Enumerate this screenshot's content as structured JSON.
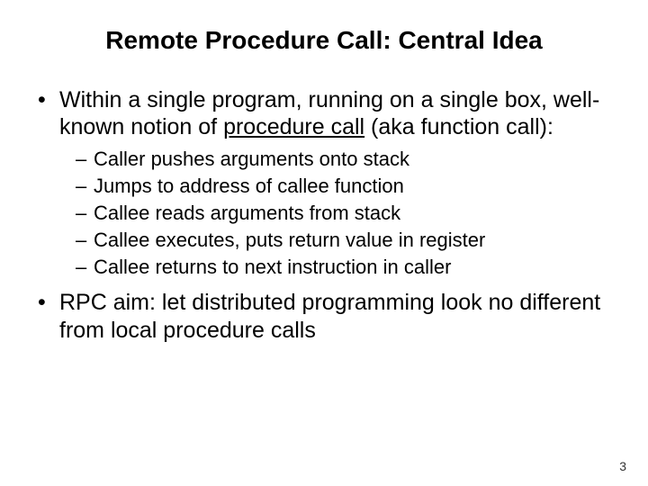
{
  "title": "Remote Procedure Call: Central Idea",
  "bullets": [
    {
      "pre": "Within a single program, running on a single box, well-known notion of ",
      "underlined": "procedure call",
      "post": " (aka function call):"
    },
    {
      "pre": "RPC aim: let distributed programming look no different from local procedure calls",
      "underlined": "",
      "post": ""
    }
  ],
  "sub": [
    "Caller pushes arguments onto stack",
    "Jumps to address of callee function",
    "Callee reads arguments from stack",
    "Callee executes, puts return value in register",
    "Callee returns to next instruction in caller"
  ],
  "page": "3"
}
